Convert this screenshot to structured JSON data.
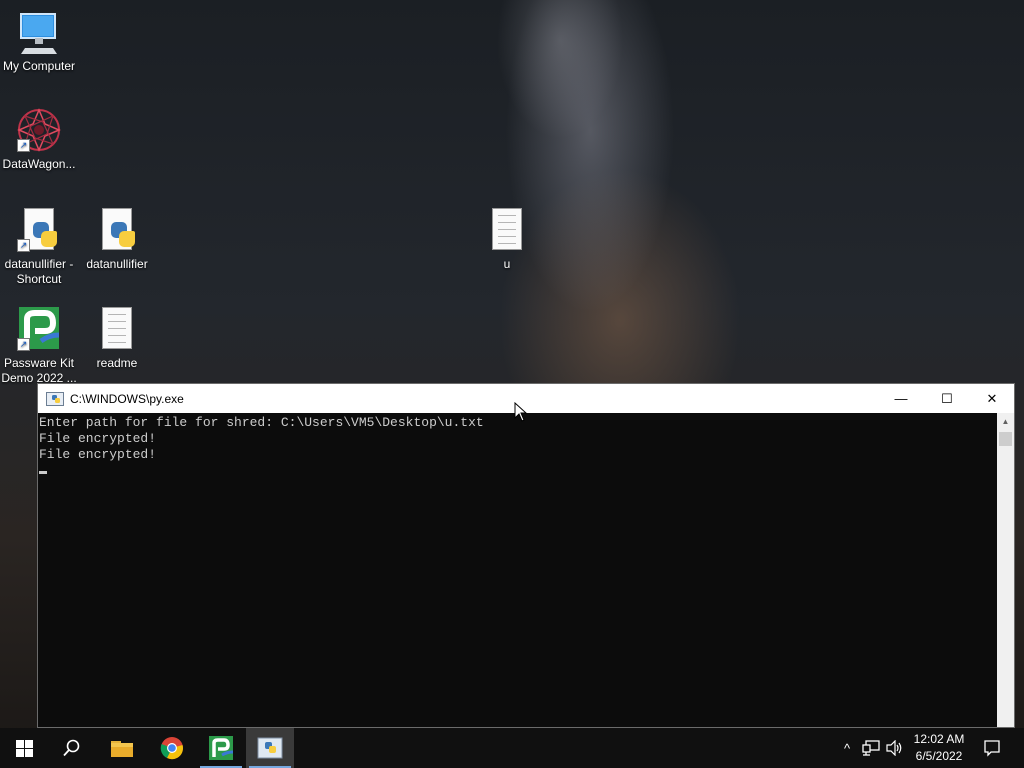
{
  "desktop": {
    "icons": [
      {
        "label": "My Computer",
        "icon": "monitor-icon",
        "shortcut": false
      },
      {
        "label": "DataWagon...",
        "icon": "datawagon-logo-icon",
        "shortcut": true
      },
      {
        "label": "datanullifier - Shortcut",
        "icon": "python-file-icon",
        "shortcut": true
      },
      {
        "label": "datanullifier",
        "icon": "python-file-icon",
        "shortcut": false
      },
      {
        "label": "Passware Kit Demo 2022 ...",
        "icon": "passware-icon",
        "shortcut": true
      },
      {
        "label": "readme",
        "icon": "text-file-icon",
        "shortcut": false
      },
      {
        "label": "u",
        "icon": "text-file-icon",
        "shortcut": false
      }
    ]
  },
  "window": {
    "title": "C:\\WINDOWS\\py.exe",
    "console_lines": [
      "Enter path for file for shred: C:\\Users\\VM5\\Desktop\\u.txt",
      "File encrypted!",
      "File encrypted!"
    ],
    "controls": {
      "minimize": "—",
      "maximize": "☐",
      "close": "✕"
    }
  },
  "taskbar": {
    "apps": [
      "start-button",
      "search",
      "file-explorer",
      "chrome",
      "passware",
      "python-console"
    ],
    "clock": {
      "time": "12:02 AM",
      "date": "6/5/2022"
    },
    "tray": {
      "chevron": "^"
    }
  },
  "colors": {
    "console_bg": "#0c0c0c",
    "console_fg": "#cccccc",
    "taskbar_bg": "#101010",
    "accent": "#76a8e0"
  }
}
